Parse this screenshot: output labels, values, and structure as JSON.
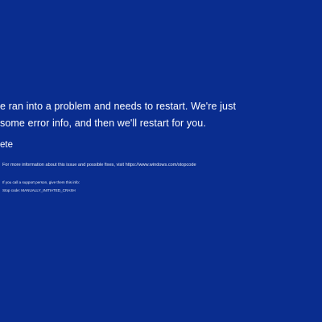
{
  "bsod": {
    "message_line1": "e ran into a problem and needs to restart. We're just",
    "message_line2": "some error info, and then we'll restart for you.",
    "progress_text": "ete",
    "info_text": "For more information about this issue and possible fixes, visit https://www.windows.com/stopcode",
    "support_text": "If you call a support person, give them this info:",
    "stop_code_text": "Stop code: MANUALLY_INITIATED_CRASH"
  },
  "colors": {
    "background": "#0a2d8f",
    "text": "#ffffff"
  }
}
